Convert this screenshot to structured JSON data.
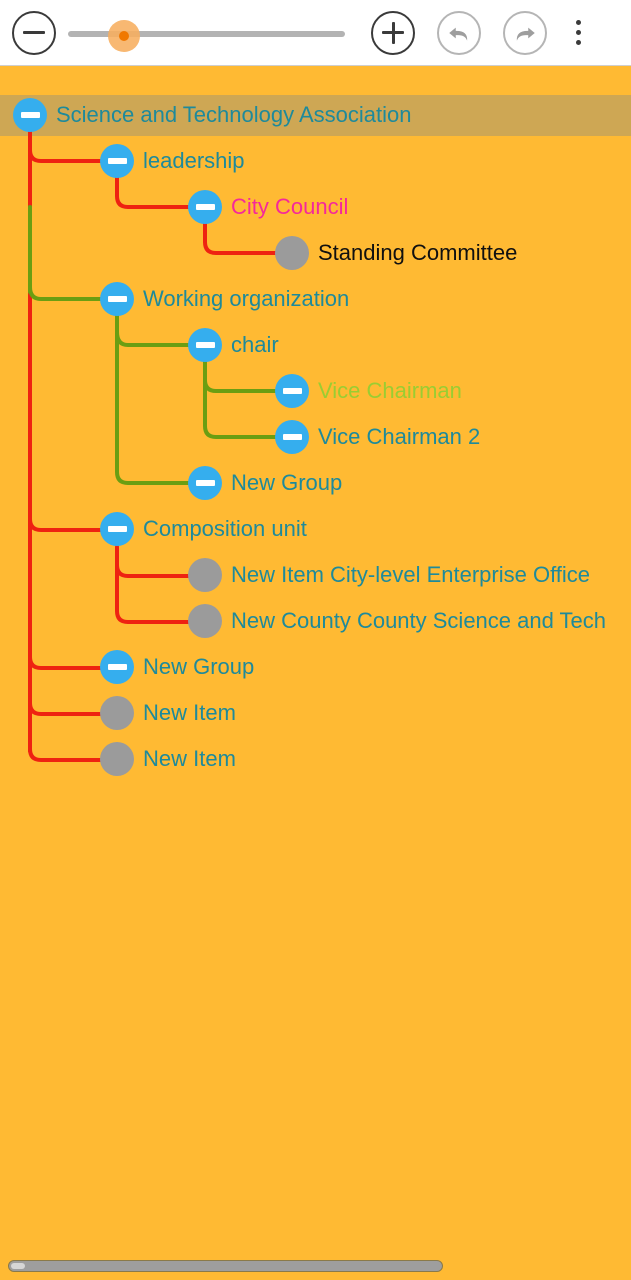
{
  "toolbar": {
    "zoom_out_label": "zoom-out",
    "zoom_in_label": "zoom-in",
    "undo_label": "undo",
    "redo_label": "redo",
    "overflow_label": "more-options",
    "slider": {
      "value": "18",
      "min": "0",
      "max": "100"
    }
  },
  "canvas": {
    "background_color": "#FFBA33",
    "selection_band_color": "#CEA754",
    "group_node_color": "#35AEEE",
    "leaf_node_color": "#9B9B9B",
    "red_link_color": "#EE2211",
    "green_link_color": "#6B9E12",
    "default_text_color": "#1E8A9B"
  },
  "tree": {
    "nodes": [
      {
        "id": "root",
        "text": "Science and Technology Association",
        "kind": "group",
        "color": "#1E8A9B",
        "selected": true
      },
      {
        "id": "leadership",
        "text": "leadership",
        "kind": "group",
        "color": "#1E8A9B"
      },
      {
        "id": "citycouncil",
        "text": "City Council",
        "kind": "group",
        "color": "#F5289B"
      },
      {
        "id": "standing",
        "text": "Standing Committee",
        "kind": "leaf",
        "color": "#101010"
      },
      {
        "id": "workingorg",
        "text": "Working organization",
        "kind": "group",
        "color": "#1E8A9B"
      },
      {
        "id": "chair",
        "text": "chair",
        "kind": "group",
        "color": "#1E8A9B"
      },
      {
        "id": "vicechair",
        "text": "Vice Chairman",
        "kind": "group",
        "color": "#9ACD32"
      },
      {
        "id": "vicechair2",
        "text": "Vice Chairman 2",
        "kind": "group",
        "color": "#1E8A9B"
      },
      {
        "id": "newgroup1",
        "text": "New Group",
        "kind": "group",
        "color": "#1E8A9B"
      },
      {
        "id": "composition",
        "text": "Composition unit",
        "kind": "group",
        "color": "#1E8A9B"
      },
      {
        "id": "newitem_city",
        "text": "New Item City-level Enterprise Office",
        "kind": "leaf",
        "color": "#1E8A9B"
      },
      {
        "id": "newcounty",
        "text": "New County County Science and Tech",
        "kind": "leaf",
        "color": "#1E8A9B"
      },
      {
        "id": "newgroup2",
        "text": "New Group",
        "kind": "group",
        "color": "#1E8A9B"
      },
      {
        "id": "newitem1",
        "text": "New Item",
        "kind": "leaf",
        "color": "#1E8A9B"
      },
      {
        "id": "newitem2",
        "text": "New Item",
        "kind": "leaf",
        "color": "#1E8A9B"
      }
    ]
  },
  "scrollbar": {
    "orientation": "horizontal",
    "position": "0"
  }
}
